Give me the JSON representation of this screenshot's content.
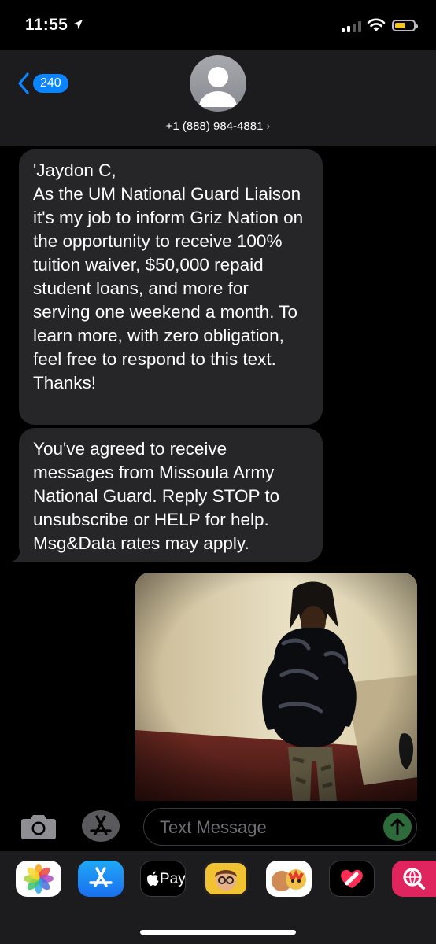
{
  "status_bar": {
    "time": "11:55",
    "icons": [
      "location-arrow-icon",
      "cellular-signal-icon",
      "wifi-icon",
      "battery-icon"
    ],
    "battery_color": "#f4c623"
  },
  "header": {
    "back_count": "240",
    "contact_number": "+1 (888) 984-4881",
    "contact_chevron": "›",
    "accent_color": "#0a84ff"
  },
  "messages": [
    {
      "direction": "received",
      "text": "'Jaydon C,\nAs the UM National Guard Liaison it's my job to inform Griz Nation on the opportunity to receive 100% tuition waiver, $50,000 repaid student loans, and more for serving one weekend a month. To learn more, with zero obligation, feel free to respond to this text. Thanks!"
    },
    {
      "direction": "received",
      "text": "You've agreed to receive messages from Missoula Army National Guard. Reply STOP to unsubscribe or HELP for help. Msg&Data rates may apply."
    },
    {
      "direction": "sent",
      "type": "photo"
    }
  ],
  "input": {
    "placeholder": "Text Message",
    "value": ""
  },
  "app_tray": {
    "apps": [
      "photos-icon",
      "app-store-icon",
      "apple-pay-icon",
      "memoji-icon",
      "animoji-icon",
      "digital-touch-icon",
      "web-search-icon"
    ],
    "apple_pay_label": "Pay"
  }
}
